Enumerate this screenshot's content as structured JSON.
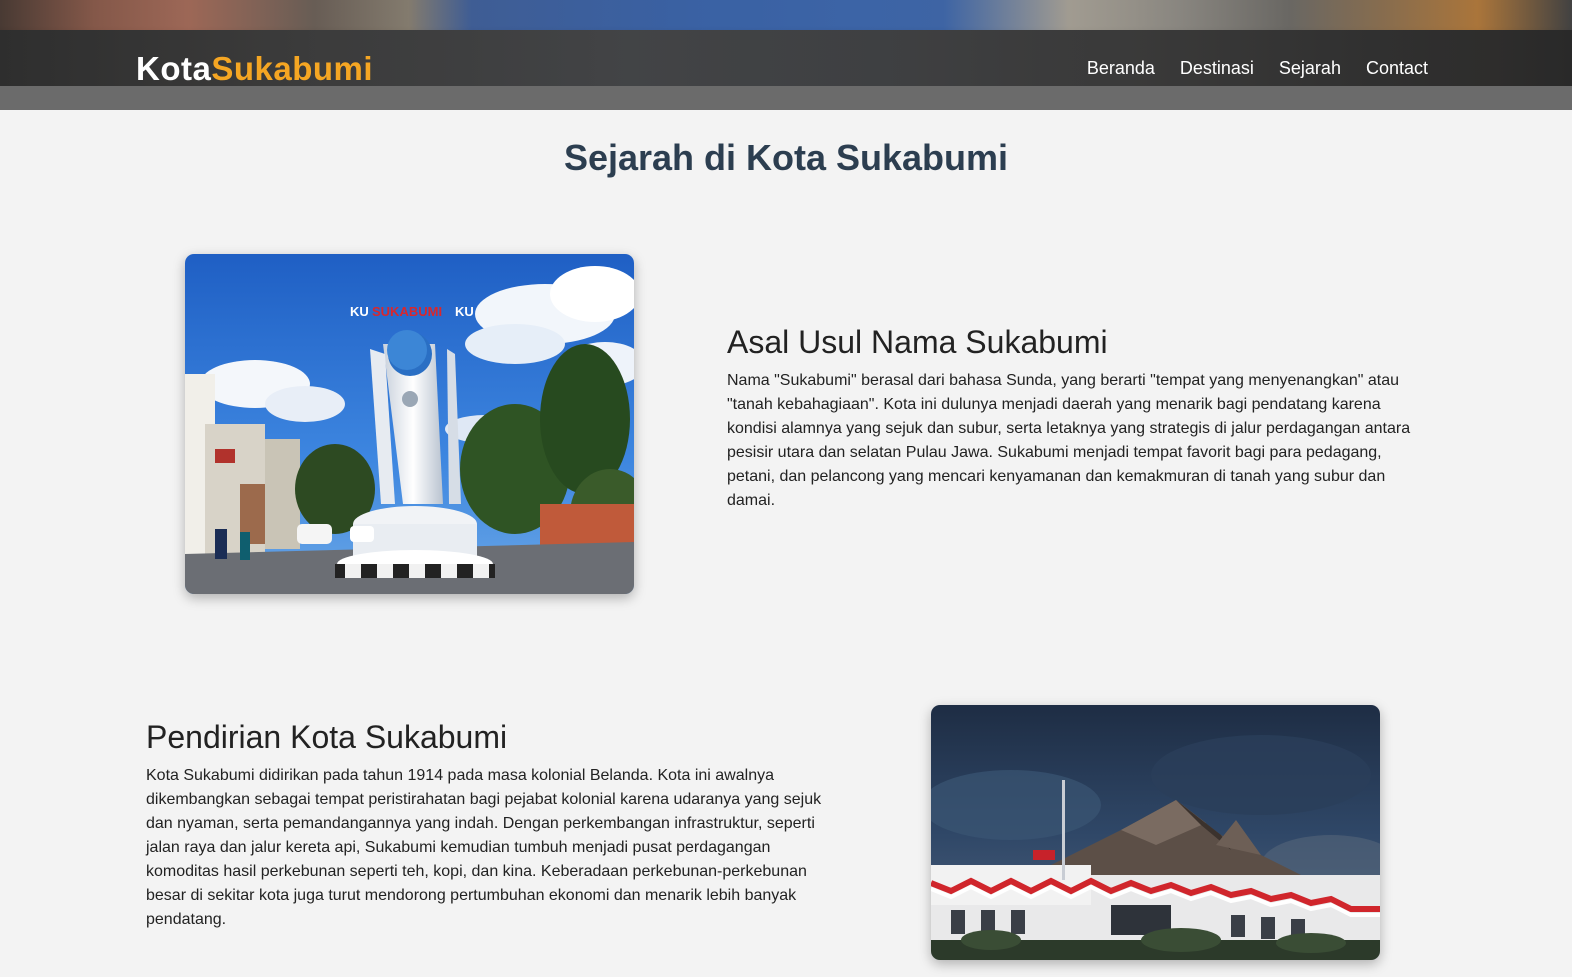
{
  "header": {
    "logo_part1": "Kota",
    "logo_part2": "Sukabumi",
    "nav": [
      {
        "label": "Beranda"
      },
      {
        "label": "Destinasi"
      },
      {
        "label": "Sejarah"
      },
      {
        "label": "Contact"
      }
    ],
    "colors": {
      "logo_accent": "#f5a623",
      "nav_text": "#ffffff"
    }
  },
  "main": {
    "title": "Sejarah di Kota Sukabumi",
    "sections": [
      {
        "title": "Asal Usul Nama Sukabumi",
        "text": "Nama \"Sukabumi\" berasal dari bahasa Sunda, yang berarti \"tempat yang menyenangkan\" atau \"tanah kebahagiaan\". Kota ini dulunya menjadi daerah yang menarik bagi pendatang karena kondisi alamnya yang sejuk dan subur, serta letaknya yang strategis di jalur perdagangan antara pesisir utara dan selatan Pulau Jawa. Sukabumi menjadi tempat favorit bagi para pedagang, petani, dan pelancong yang mencari kenyamanan dan kemakmuran di tanah yang subur dan damai.",
        "image_sign": "KUSUKABUMIKU"
      },
      {
        "title": "Pendirian Kota Sukabumi",
        "text": "Kota Sukabumi didirikan pada tahun 1914 pada masa kolonial Belanda. Kota ini awalnya dikembangkan sebagai tempat peristirahatan bagi pejabat kolonial karena udaranya yang sejuk dan nyaman, serta pemandangannya yang indah. Dengan perkembangan infrastruktur, seperti jalan raya dan jalur kereta api, Sukabumi kemudian tumbuh menjadi pusat perdagangan komoditas hasil perkebunan seperti teh, kopi, dan kina. Keberadaan perkebunan-perkebunan besar di sekitar kota juga turut mendorong pertumbuhan ekonomi dan menarik lebih banyak pendatang."
      }
    ],
    "colors": {
      "title": "#2c3e50",
      "background": "#f3f3f3"
    }
  }
}
